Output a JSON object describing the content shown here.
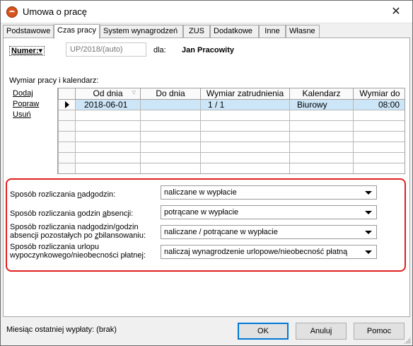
{
  "window": {
    "title": "Umowa o pracę",
    "close": "✕"
  },
  "tabs": [
    "Podstawowe",
    "Czas pracy",
    "System wynagrodzeń",
    "ZUS",
    "Dodatkowe",
    "Inne",
    "Własne"
  ],
  "numer": {
    "label": "Numer:",
    "placeholder": "UP/2018/(auto)",
    "dla": "dla:",
    "person": "Jan Pracowity"
  },
  "calendar": {
    "section_label": "Wymiar pracy i kalendarz:",
    "actions": {
      "add": "Dodaj",
      "edit": "Popraw",
      "delete": "Usuń"
    },
    "columns": [
      "Od dnia",
      "Do dnia",
      "Wymiar zatrudnienia",
      "Kalendarz",
      "Wymiar do"
    ],
    "rows": [
      {
        "od": "2018-06-01",
        "do": "",
        "wymiar": "1 / 1",
        "kalendarz": "Biurowy",
        "wymiar_do": "08:00"
      }
    ]
  },
  "settings": {
    "nadgodziny": {
      "label_pre": "Sposób rozliczania ",
      "label_u": "n",
      "label_post": "adgodzin:",
      "value": "naliczane w wypłacie"
    },
    "absencje": {
      "label_pre": "Sposób rozliczania godzin ",
      "label_u": "a",
      "label_post": "bsencji:",
      "value": "potrącane w wypłacie"
    },
    "zbilansowanie": {
      "line1": "Sposób rozliczania nadgodzin/godzin",
      "line2_pre": "absencji pozostałych po ",
      "line2_u": "z",
      "line2_post": "bilansowaniu:",
      "value": "naliczane / potrącane w wypłacie"
    },
    "urlop": {
      "line1": "Sposób rozliczania urlopu",
      "line2": "wypoczynkowego/nieobecności płatnej:",
      "value": "naliczaj wynagrodzenie urlopowe/nieobecność płatną"
    }
  },
  "footer": {
    "last_payout": "Miesiąc ostatniej wypłaty: (brak)",
    "ok": "OK",
    "cancel": "Anuluj",
    "help": "Pomoc"
  },
  "colors": {
    "selection": "#cde6f7",
    "highlight_border": "#e02020",
    "default_button": "#0078d7"
  }
}
